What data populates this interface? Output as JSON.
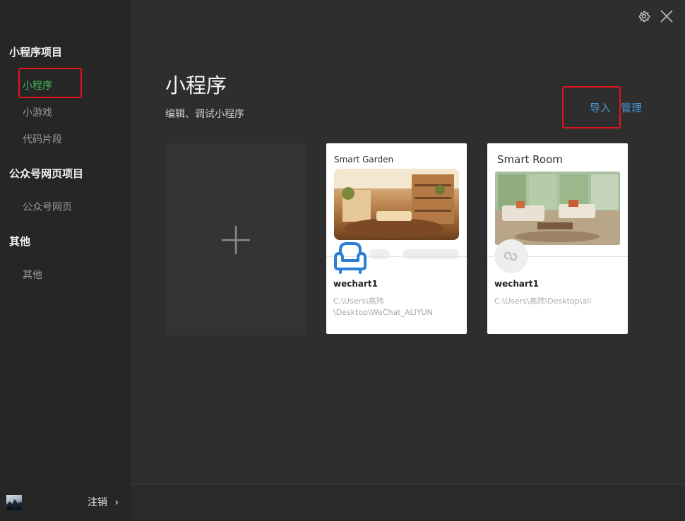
{
  "sidebar": {
    "sections": [
      {
        "title": "小程序项目",
        "items": [
          "小程序",
          "小游戏",
          "代码片段"
        ]
      },
      {
        "title": "公众号网页项目",
        "items": [
          "公众号网页"
        ]
      },
      {
        "title": "其他",
        "items": [
          "其他"
        ]
      }
    ],
    "active_item": "小程序",
    "logout_label": "注销",
    "logout_chevron": "›"
  },
  "header": {
    "title": "小程序",
    "subtitle": "编辑、调试小程序",
    "import_label": "导入",
    "manage_label": "管理"
  },
  "window_controls": {
    "settings_icon": "gear-icon",
    "close_icon": "close-icon"
  },
  "new_project": {
    "icon": "plus-icon"
  },
  "projects": [
    {
      "header": "Smart Garden",
      "name": "wechart1",
      "path_line1": "C:\\Users\\高玮",
      "path_line2": "\\Desktop\\WeChat_ALIYUN",
      "icon": "sofa-icon"
    },
    {
      "header": "Smart Room",
      "name": "wechart1",
      "path_line1": "C:\\Users\\高玮\\Desktop\\ali",
      "icon": "miniprogram-logo-icon"
    }
  ],
  "colors": {
    "active_nav": "#3fbf5a",
    "link": "#4a9ad8",
    "highlight_box": "#e0141b",
    "background": "#2e2e2e",
    "sidebar": "#262626"
  }
}
